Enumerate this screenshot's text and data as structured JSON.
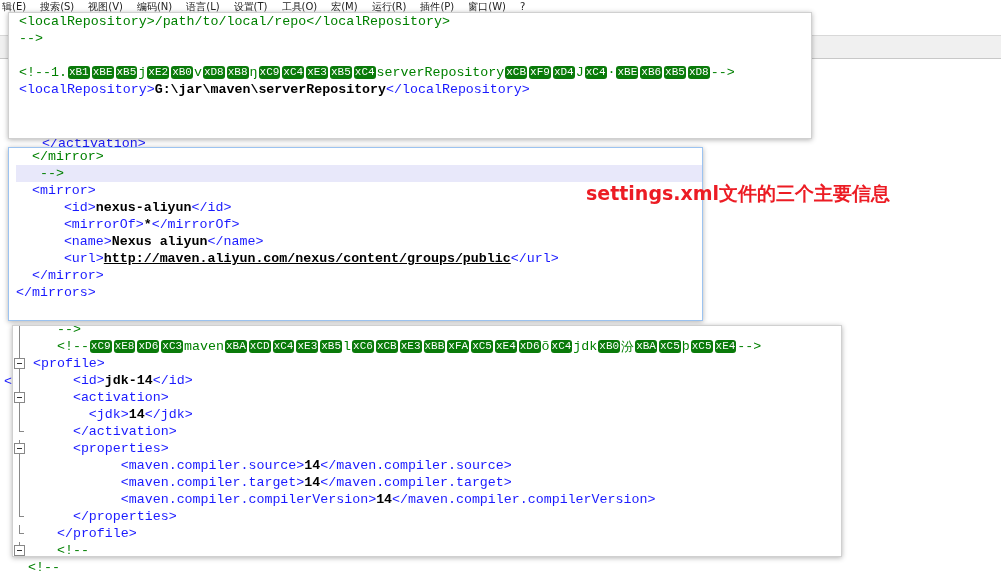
{
  "menu": [
    {
      "label": "辑(E)"
    },
    {
      "label": "搜索(S)"
    },
    {
      "label": "视图(V)"
    },
    {
      "label": "编码(N)"
    },
    {
      "label": "语言(L)"
    },
    {
      "label": "设置(T)"
    },
    {
      "label": "工具(O)"
    },
    {
      "label": "宏(M)"
    },
    {
      "label": "运行(R)"
    },
    {
      "label": "插件(P)"
    },
    {
      "label": "窗口(W)"
    },
    {
      "label": "?"
    }
  ],
  "background_lines": [
    {
      "tokens": [
        {
          "kind": "tag",
          "text": "</activation>"
        }
      ]
    },
    {
      "tokens": [
        {
          "kind": "tag",
          "text": "<"
        }
      ]
    },
    {
      "tokens": [
        {
          "kind": "comment",
          "text": "<!--"
        }
      ]
    }
  ],
  "snippets": [
    {
      "lines": [
        {
          "kind": "code",
          "tokens": [
            {
              "kind": "comment",
              "text": "<localRepository>/path/to/local/repo</localRepository>"
            }
          ]
        },
        {
          "kind": "code",
          "tokens": [
            {
              "kind": "comment",
              "text": "-->"
            }
          ]
        },
        {
          "kind": "blank"
        },
        {
          "kind": "code",
          "tokens": [
            {
              "kind": "comment",
              "text": "<!--1."
            },
            {
              "kind": "byte",
              "text": "xB1"
            },
            {
              "kind": "byte",
              "text": "xBE"
            },
            {
              "kind": "byte",
              "text": "xB5"
            },
            {
              "kind": "comment",
              "text": "j"
            },
            {
              "kind": "byte",
              "text": "xE2"
            },
            {
              "kind": "byte",
              "text": "xB0"
            },
            {
              "kind": "comment",
              "text": "v"
            },
            {
              "kind": "byte",
              "text": "xD8"
            },
            {
              "kind": "byte",
              "text": "xB8"
            },
            {
              "kind": "comment",
              "text": "ŋ"
            },
            {
              "kind": "byte",
              "text": "xC9"
            },
            {
              "kind": "byte",
              "text": "xC4"
            },
            {
              "kind": "byte",
              "text": "xE3"
            },
            {
              "kind": "byte",
              "text": "xB5"
            },
            {
              "kind": "byte",
              "text": "xC4"
            },
            {
              "kind": "comment",
              "text": "serverRepository"
            },
            {
              "kind": "byte",
              "text": "xCB"
            },
            {
              "kind": "byte",
              "text": "xF9"
            },
            {
              "kind": "byte",
              "text": "xD4"
            },
            {
              "kind": "comment",
              "text": "J"
            },
            {
              "kind": "byte",
              "text": "xC4"
            },
            {
              "kind": "comment",
              "text": "·"
            },
            {
              "kind": "byte",
              "text": "xBE"
            },
            {
              "kind": "byte",
              "text": "xB6"
            },
            {
              "kind": "byte",
              "text": "xB5"
            },
            {
              "kind": "byte",
              "text": "xD8"
            },
            {
              "kind": "comment",
              "text": "-->"
            }
          ]
        },
        {
          "kind": "code",
          "tokens": [
            {
              "kind": "tag",
              "text": "<localRepository>"
            },
            {
              "kind": "value",
              "text": "G:\\jar\\maven\\serverRepository"
            },
            {
              "kind": "tag",
              "text": "</localRepository>"
            }
          ]
        }
      ]
    },
    {
      "lines": [
        {
          "kind": "code",
          "highlighted": false,
          "tokens": [
            {
              "kind": "comment",
              "text": "  </mirror>"
            }
          ]
        },
        {
          "kind": "code",
          "highlighted": true,
          "tokens": [
            {
              "kind": "comment",
              "text": "   -->"
            }
          ]
        },
        {
          "kind": "code",
          "highlighted": false,
          "tokens": [
            {
              "kind": "tag",
              "text": "  <mirror>"
            }
          ]
        },
        {
          "kind": "code",
          "highlighted": false,
          "tokens": [
            {
              "kind": "tag",
              "text": "      <id>"
            },
            {
              "kind": "value",
              "text": "nexus-aliyun"
            },
            {
              "kind": "tag",
              "text": "</id>"
            }
          ]
        },
        {
          "kind": "code",
          "highlighted": false,
          "tokens": [
            {
              "kind": "tag",
              "text": "      <mirrorOf>"
            },
            {
              "kind": "value",
              "text": "*"
            },
            {
              "kind": "tag",
              "text": "</mirrorOf>"
            }
          ]
        },
        {
          "kind": "code",
          "highlighted": false,
          "tokens": [
            {
              "kind": "tag",
              "text": "      <name>"
            },
            {
              "kind": "value",
              "text": "Nexus aliyun"
            },
            {
              "kind": "tag",
              "text": "</name>"
            }
          ]
        },
        {
          "kind": "code",
          "highlighted": false,
          "tokens": [
            {
              "kind": "tag",
              "text": "      <url>"
            },
            {
              "kind": "url",
              "text": "http://maven.aliyun.com/nexus/content/groups/public"
            },
            {
              "kind": "tag",
              "text": "</url>"
            }
          ]
        },
        {
          "kind": "code",
          "highlighted": false,
          "tokens": [
            {
              "kind": "tag",
              "text": "  </mirror>"
            }
          ]
        },
        {
          "kind": "code",
          "highlighted": false,
          "tokens": [
            {
              "kind": "tag",
              "text": "</mirrors>"
            }
          ]
        }
      ]
    },
    {
      "lines": [
        {
          "kind": "code",
          "fold_start": false,
          "fold_end": false,
          "tokens": [
            {
              "kind": "comment",
              "text": "   -->"
            }
          ]
        },
        {
          "kind": "code",
          "fold_start": false,
          "fold_end": false,
          "tokens": [
            {
              "kind": "comment",
              "text": "   <!--"
            },
            {
              "kind": "byte",
              "text": "xC9"
            },
            {
              "kind": "byte",
              "text": "xE8"
            },
            {
              "kind": "byte",
              "text": "xD6"
            },
            {
              "kind": "byte",
              "text": "xC3"
            },
            {
              "kind": "comment",
              "text": "maven"
            },
            {
              "kind": "byte",
              "text": "xBA"
            },
            {
              "kind": "byte",
              "text": "xCD"
            },
            {
              "kind": "byte",
              "text": "xC4"
            },
            {
              "kind": "byte",
              "text": "xE3"
            },
            {
              "kind": "byte",
              "text": "xB5"
            },
            {
              "kind": "comment",
              "text": "l"
            },
            {
              "kind": "byte",
              "text": "xC6"
            },
            {
              "kind": "byte",
              "text": "xCB"
            },
            {
              "kind": "byte",
              "text": "xE3"
            },
            {
              "kind": "byte",
              "text": "xBB"
            },
            {
              "kind": "byte",
              "text": "xFA"
            },
            {
              "kind": "byte",
              "text": "xC5"
            },
            {
              "kind": "byte",
              "text": "xE4"
            },
            {
              "kind": "byte",
              "text": "xD6"
            },
            {
              "kind": "comment",
              "text": "õ"
            },
            {
              "kind": "byte",
              "text": "xC4"
            },
            {
              "kind": "comment",
              "text": "jdk"
            },
            {
              "kind": "byte",
              "text": "xB0"
            },
            {
              "kind": "comment",
              "text": "汾"
            },
            {
              "kind": "byte",
              "text": "xBA"
            },
            {
              "kind": "byte",
              "text": "xC5"
            },
            {
              "kind": "comment",
              "text": "þ"
            },
            {
              "kind": "byte",
              "text": "xC5"
            },
            {
              "kind": "byte",
              "text": "xE4"
            },
            {
              "kind": "comment",
              "text": "-->"
            }
          ]
        },
        {
          "kind": "code",
          "fold_start": true,
          "fold_end": false,
          "tokens": [
            {
              "kind": "tag",
              "text": "<profile>"
            }
          ]
        },
        {
          "kind": "code",
          "fold_start": false,
          "fold_end": false,
          "tokens": [
            {
              "kind": "tag",
              "text": "     <id>"
            },
            {
              "kind": "value",
              "text": "jdk-14"
            },
            {
              "kind": "tag",
              "text": "</id>"
            }
          ]
        },
        {
          "kind": "code",
          "fold_start": true,
          "fold_end": false,
          "tokens": [
            {
              "kind": "tag",
              "text": "     <activation>"
            }
          ]
        },
        {
          "kind": "code",
          "fold_start": false,
          "fold_end": false,
          "tokens": [
            {
              "kind": "tag",
              "text": "       <jdk>"
            },
            {
              "kind": "value",
              "text": "14"
            },
            {
              "kind": "tag",
              "text": "</jdk>"
            }
          ]
        },
        {
          "kind": "code",
          "fold_start": false,
          "fold_end": true,
          "tokens": [
            {
              "kind": "tag",
              "text": "     </activation>"
            }
          ]
        },
        {
          "kind": "code",
          "fold_start": true,
          "fold_end": false,
          "tokens": [
            {
              "kind": "tag",
              "text": "     <properties>"
            }
          ]
        },
        {
          "kind": "code",
          "fold_start": false,
          "fold_end": false,
          "tokens": [
            {
              "kind": "tag",
              "text": "           <maven.compiler.source>"
            },
            {
              "kind": "value",
              "text": "14"
            },
            {
              "kind": "tag",
              "text": "</maven.compiler.source>"
            }
          ]
        },
        {
          "kind": "code",
          "fold_start": false,
          "fold_end": false,
          "tokens": [
            {
              "kind": "tag",
              "text": "           <maven.compiler.target>"
            },
            {
              "kind": "value",
              "text": "14"
            },
            {
              "kind": "tag",
              "text": "</maven.compiler.target>"
            }
          ]
        },
        {
          "kind": "code",
          "fold_start": false,
          "fold_end": false,
          "tokens": [
            {
              "kind": "tag",
              "text": "           <maven.compiler.compilerVersion>"
            },
            {
              "kind": "value",
              "text": "14"
            },
            {
              "kind": "tag",
              "text": "</maven.compiler.compilerVersion>"
            }
          ]
        },
        {
          "kind": "code",
          "fold_start": false,
          "fold_end": true,
          "tokens": [
            {
              "kind": "tag",
              "text": "     </properties>"
            }
          ]
        },
        {
          "kind": "code",
          "fold_start": false,
          "fold_end": true,
          "tokens": [
            {
              "kind": "tag",
              "text": "   </profile>"
            }
          ]
        },
        {
          "kind": "code",
          "fold_start": true,
          "fold_end": false,
          "tokens": [
            {
              "kind": "comment",
              "text": "   <!--"
            }
          ]
        }
      ]
    }
  ],
  "annotation": "settings.xml文件的三个主要信息"
}
